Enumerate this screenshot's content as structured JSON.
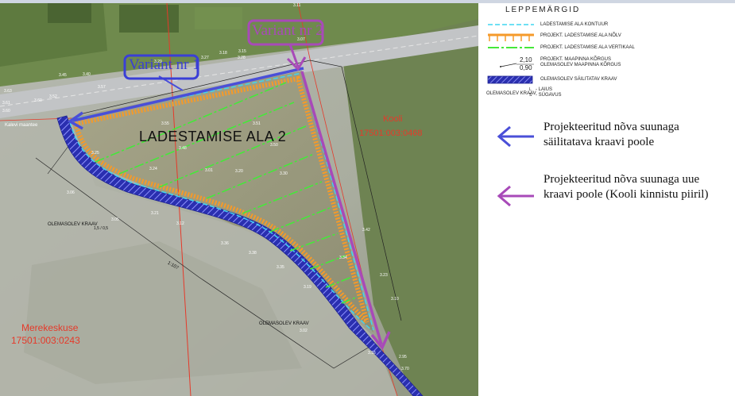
{
  "map": {
    "area_title": "LADESTAMISE ALA 2",
    "variant_1": "Variant nr 1",
    "variant_2": "Variant nr 2",
    "parcel_kooli": {
      "name": "Kooli",
      "code": "17501:003:0468"
    },
    "parcel_merekeskuse": {
      "name": "Merekeskuse",
      "code": "17501:003:0243"
    },
    "ditch_label_1": "OLEMASOLEV KRAAV",
    "ditch_label_2": "OLEMASOLEV KRAAV",
    "ditch_label_3": "OLEMASOLEV KRAAV",
    "ditch_dim": "1,5 / 0,5",
    "dim_side": "1:107",
    "road_label": "Kalevi maantee",
    "elevations": [
      "3.11",
      "3.07",
      "3.27",
      "3.18",
      "3.15",
      "3.28",
      "3.29",
      "3.40",
      "3.45",
      "3.57",
      "3.63",
      "3.61",
      "3.60",
      "3.52",
      "3.60",
      "3.55",
      "3.48",
      "3.51",
      "3.50",
      "3.30",
      "3.20",
      "3.01",
      "3.24",
      "3.12",
      "3.36",
      "3.38",
      "3.35",
      "3.19",
      "3.02",
      "3.34",
      "3.42",
      "3.23",
      "3.10",
      "3.16",
      "2.95",
      "3.70",
      "3.06",
      "3.05",
      "3.21",
      "3.25"
    ],
    "colors": {
      "contour": "#3fd5f0",
      "slope": "#f59a2a",
      "vertical": "#45e83a",
      "ditch": "#3a3fd6",
      "variant_1": "#4a4fd8",
      "variant_2": "#a84ab8",
      "parcel": "#e53a2a"
    }
  },
  "legend": {
    "title": "LEPPEMÄRGID",
    "items": [
      {
        "label": "LADESTAMISE ALA KONTUUR",
        "symbol": "contour-line-icon"
      },
      {
        "label": "PROJEKT. LADESTAMISE ALA NÕLV",
        "symbol": "slope-hatch-icon"
      },
      {
        "label": "PROJEKT. LADESTAMISE ALA VERTIKAAL",
        "symbol": "vertical-line-icon"
      },
      {
        "label": "PROJEKT. MAAPINNA KÕRGUS",
        "label2": "OLEMASOLEV MAAPINNA KÕRGUS",
        "top": "2,10",
        "bottom": "0,90",
        "symbol": "elevation-icon"
      },
      {
        "label": "OLEMASOLEV SÄILITATAV KRAAV",
        "symbol": "ditch-hatch-icon"
      },
      {
        "label": "OLEMASOLEV KRAAV",
        "w_label": "- LAIUS",
        "d_label": "- SÜGAVUS",
        "w": "L",
        "d": "S",
        "symbol": "ditch-size-icon"
      }
    ],
    "arrow_notes": [
      {
        "text": "Projekteeritud nõva suunaga säilitatava kraavi poole",
        "color": "#4a4fd8"
      },
      {
        "text": "Projekteeritud nõva suunaga uue kraavi poole (Kooli kinnistu piiril)",
        "color": "#a84ab8"
      }
    ]
  }
}
